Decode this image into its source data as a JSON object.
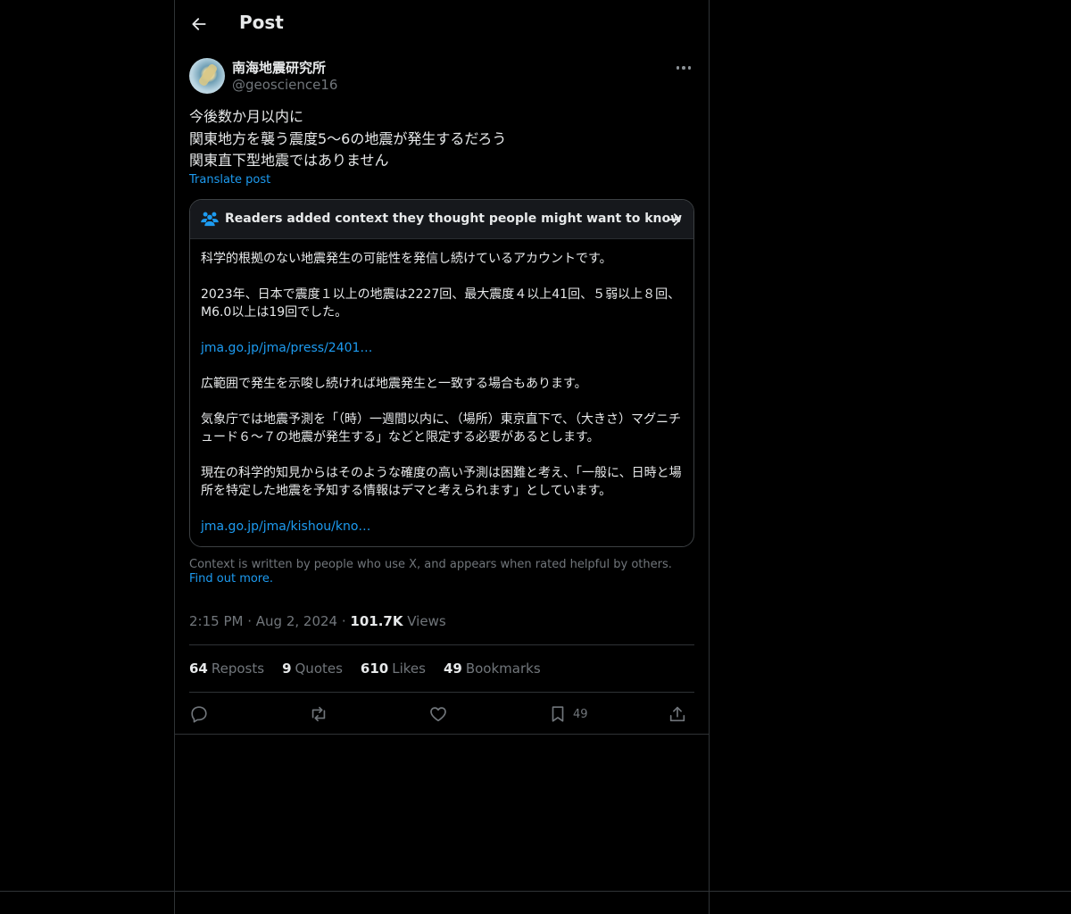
{
  "header": {
    "title": "Post"
  },
  "author": {
    "display_name": "南海地震研究所",
    "handle": "@geoscience16"
  },
  "post": {
    "lines": [
      "今後数か月以内に",
      "関東地方を襲う震度5〜6の地震が発生するだろう",
      "関東直下型地震ではありません"
    ],
    "translate_label": "Translate post"
  },
  "community_note": {
    "title": "Readers added context they thought people might want to know",
    "paragraphs": [
      "科学的根拠のない地震発生の可能性を発信し続けているアカウントです。",
      "2023年、日本で震度１以上の地震は2227回、最大震度４以上41回、５弱以上８回、M6.0以上は19回でした。",
      "広範囲で発生を示唆し続ければ地震発生と一致する場合もあります。",
      "気象庁では地震予測を「（時）一週間以内に、（場所）東京直下で、（大きさ）マグニチュード６〜７の地震が発生する」などと限定する必要があるとします。",
      "現在の科学的知見からはそのような確度の高い予測は困難と考え、「一般に、日時と場所を特定した地震を予知する情報はデマと考えられます」としています。"
    ],
    "links": [
      "jma.go.jp/jma/press/2401…",
      "jma.go.jp/jma/kishou/kno…"
    ]
  },
  "context_footer": {
    "text": "Context is written by people who use X, and appears when rated helpful by others.",
    "link": "Find out more."
  },
  "meta": {
    "time": "2:15 PM",
    "date": "Aug 2, 2024",
    "views_count": "101.7K",
    "views_label": "Views"
  },
  "stats": {
    "reposts": "64",
    "reposts_label": "Reposts",
    "quotes": "9",
    "quotes_label": "Quotes",
    "likes": "610",
    "likes_label": "Likes",
    "bookmarks": "49",
    "bookmarks_label": "Bookmarks"
  },
  "actions": {
    "bookmark_count": "49"
  },
  "icons": {
    "back": "arrow-left-icon",
    "more": "more-horizontal-icon",
    "note": "people-icon",
    "note_arrow": "arrow-right-icon",
    "reply": "reply-icon",
    "repost": "repost-icon",
    "like": "heart-icon",
    "bookmark": "bookmark-icon",
    "share": "share-icon"
  },
  "colors": {
    "background": "#000000",
    "text": "#e7e9ea",
    "muted": "#71767b",
    "link": "#1d9bf0",
    "border": "#2f3336"
  }
}
